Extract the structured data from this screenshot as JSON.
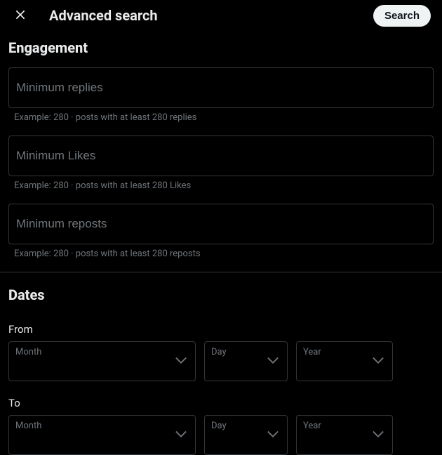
{
  "header": {
    "title": "Advanced search",
    "search_button": "Search"
  },
  "engagement": {
    "heading": "Engagement",
    "min_replies": {
      "placeholder": "Minimum replies",
      "hint": "Example: 280 · posts with at least 280 replies"
    },
    "min_likes": {
      "placeholder": "Minimum Likes",
      "hint": "Example: 280 · posts with at least 280 Likes"
    },
    "min_reposts": {
      "placeholder": "Minimum reposts",
      "hint": "Example: 280 · posts with at least 280 reposts"
    }
  },
  "dates": {
    "heading": "Dates",
    "from_label": "From",
    "to_label": "To",
    "month_label": "Month",
    "day_label": "Day",
    "year_label": "Year"
  }
}
